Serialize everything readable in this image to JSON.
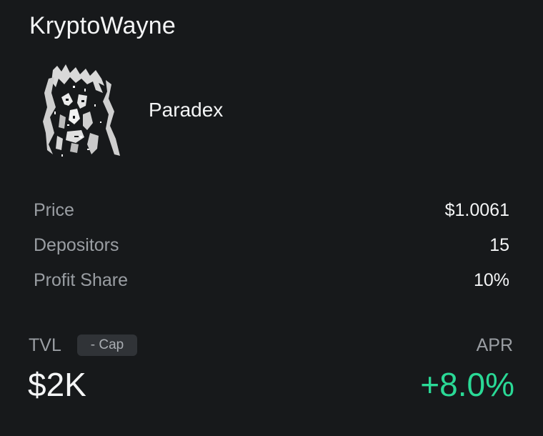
{
  "vault": {
    "title": "KryptoWayne",
    "platform": "Paradex",
    "avatar_icon": "grayscale-portrait-avatar"
  },
  "stats": [
    {
      "label": "Price",
      "value": "$1.0061"
    },
    {
      "label": "Depositors",
      "value": "15"
    },
    {
      "label": "Profit Share",
      "value": "10%"
    }
  ],
  "tvl": {
    "label": "TVL",
    "cap_badge": "- Cap",
    "value": "$2K"
  },
  "apr": {
    "label": "APR",
    "value": "+8.0%",
    "color": "#2ad996"
  },
  "colors": {
    "background": "#17191b",
    "primary_text": "#f4f5f6",
    "secondary_text": "#9a9ea3",
    "badge_bg": "#303337",
    "positive": "#2ad996"
  }
}
